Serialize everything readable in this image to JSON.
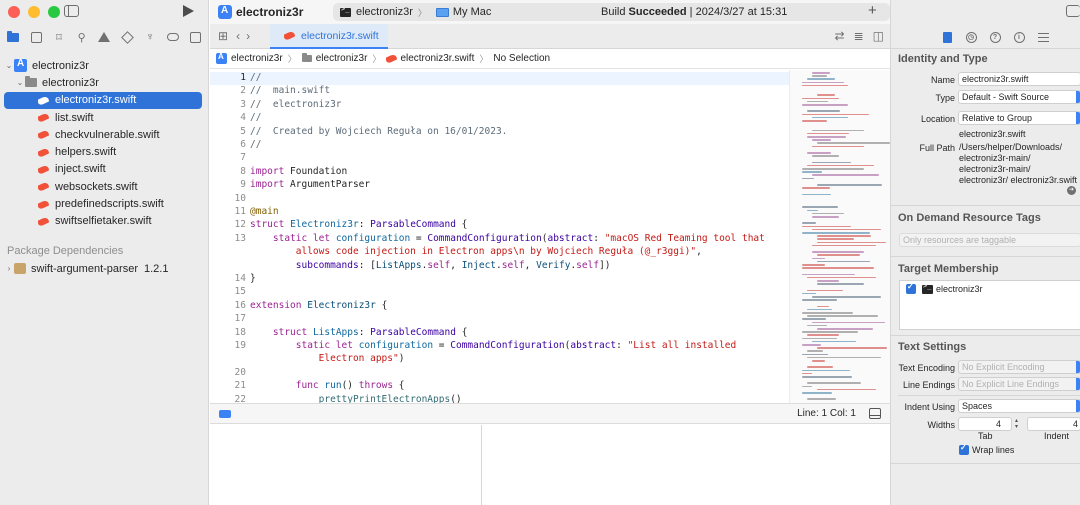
{
  "navigator": {
    "project": "electroniz3r",
    "group": "electroniz3r",
    "files": [
      {
        "name": "electroniz3r.swift",
        "selected": true
      },
      {
        "name": "list.swift"
      },
      {
        "name": "checkvulnerable.swift"
      },
      {
        "name": "helpers.swift"
      },
      {
        "name": "inject.swift"
      },
      {
        "name": "websockets.swift"
      },
      {
        "name": "predefinedscripts.swift"
      },
      {
        "name": "swiftselfietaker.swift"
      }
    ],
    "package_section": "Package Dependencies",
    "package": {
      "name": "swift-argument-parser",
      "version": "1.2.1"
    }
  },
  "toolbar": {
    "title": "electroniz3r",
    "scheme_target": "electroniz3r",
    "scheme_destination": "My Mac",
    "build_prefix": "Build ",
    "build_result": "Succeeded",
    "build_time": " | 2024/3/27 at 15:31",
    "add_symbol": "+"
  },
  "tab": {
    "active_label": "electroniz3r.swift"
  },
  "jumpbar": {
    "project": "electroniz3r",
    "group": "electroniz3r",
    "file": "electroniz3r.swift",
    "selection": "No Selection"
  },
  "editor": {
    "line_numbers": [
      "1",
      "2",
      "3",
      "4",
      "5",
      "6",
      "7",
      "8",
      "9",
      "10",
      "11",
      "12",
      "13",
      "",
      "",
      "14",
      "15",
      "16",
      "17",
      "18",
      "19",
      "",
      "20",
      "21",
      "22"
    ],
    "current_line": "1"
  },
  "status": {
    "line_col": "Line: 1  Col: 1"
  },
  "inspector": {
    "identity_header": "Identity and Type",
    "name_label": "Name",
    "name_value": "electroniz3r.swift",
    "type_label": "Type",
    "type_value": "Default - Swift Source",
    "location_label": "Location",
    "location_value": "Relative to Group",
    "location_file": "electroniz3r.swift",
    "full_path_label": "Full Path",
    "full_path_value": "/Users/helper/Downloads/ electroniz3r-main/ electroniz3r-main/ electroniz3r/ electroniz3r.swift",
    "tags_header": "On Demand Resource Tags",
    "tags_placeholder": "Only resources are taggable",
    "membership_header": "Target Membership",
    "membership_target": "electroniz3r",
    "text_settings_header": "Text Settings",
    "encoding_label": "Text Encoding",
    "encoding_value": "No Explicit Encoding",
    "line_endings_label": "Line Endings",
    "line_endings_value": "No Explicit Line Endings",
    "indent_using_label": "Indent Using",
    "indent_using_value": "Spaces",
    "widths_label": "Widths",
    "tab_width": "4",
    "indent_width": "4",
    "tab_label": "Tab",
    "indent_label": "Indent",
    "wrap_label": "Wrap lines"
  },
  "colors": {
    "accent": "#2f73d9",
    "swift": "#f05138"
  },
  "icons": [
    "sidebar-icon",
    "run-icon",
    "folder-icon",
    "search-icon",
    "warning-icon",
    "breakpoint-icon",
    "document-icon",
    "history-icon",
    "help-icon"
  ]
}
